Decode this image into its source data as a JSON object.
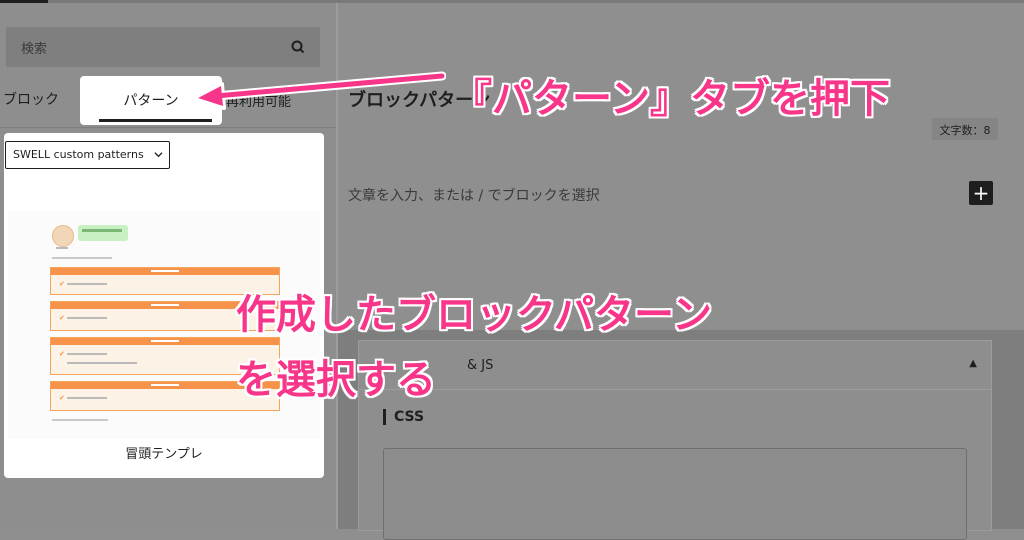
{
  "inserter": {
    "search_placeholder": "検索",
    "tabs": {
      "blocks": "ブロック",
      "patterns": "パターン",
      "reusable": "再利用可能"
    },
    "category_select": "SWELL custom patterns",
    "pattern": {
      "title": "冒頭テンプレ"
    }
  },
  "editor": {
    "title": "ブロックパターン",
    "word_count": "文字数：8",
    "placeholder": "文章を入力、または / でブロックを選択",
    "add_button": "+",
    "meta_box_title": "& JS",
    "css_label": "CSS"
  },
  "annotations": {
    "tab_hint": "『パターン』タブを押下",
    "select_hint_line1": "作成したブロックパターン",
    "select_hint_line2": "を選択する"
  },
  "colors": {
    "annotation": "#f7368a",
    "pattern_accent": "#f7924a"
  }
}
